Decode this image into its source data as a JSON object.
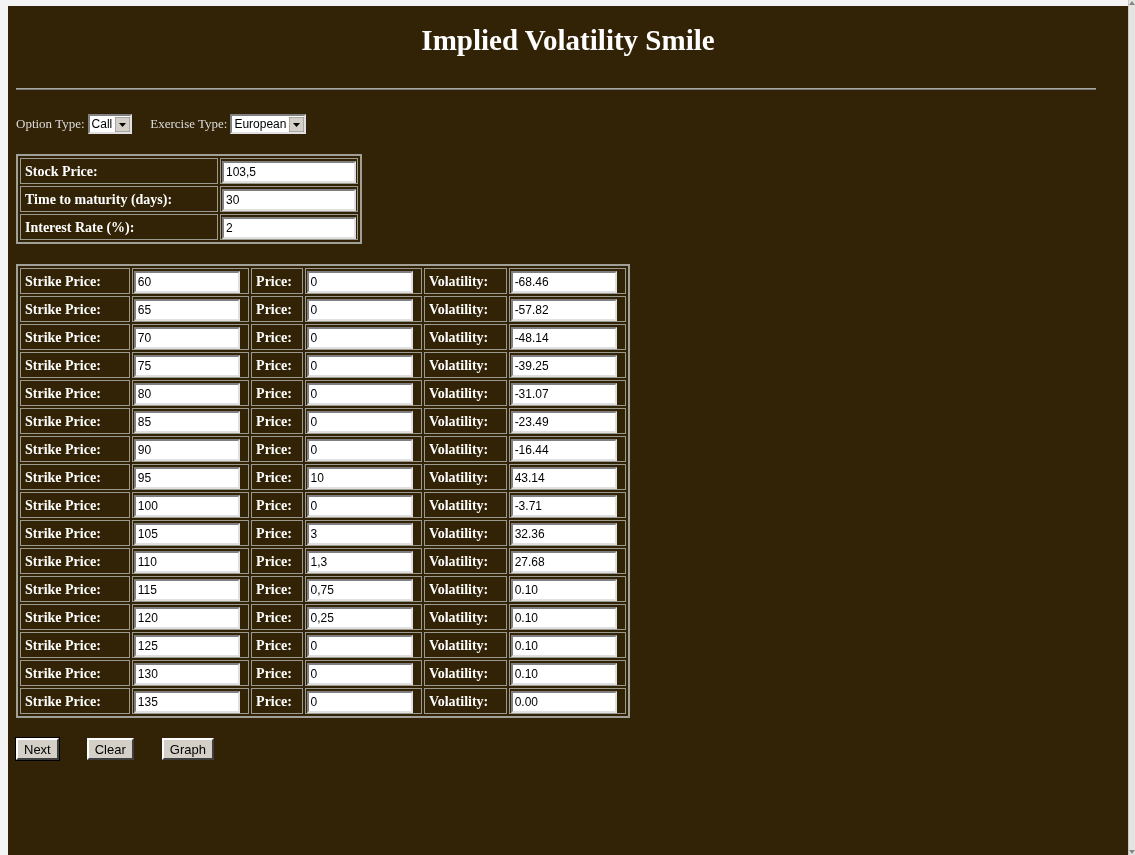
{
  "title": "Implied Volatility Smile",
  "options": [
    {
      "label": "Option Type:",
      "value": "Call"
    },
    {
      "label": "Exercise Type:",
      "value": "European"
    }
  ],
  "inputs": [
    {
      "label": "Stock Price:",
      "value": "103,5"
    },
    {
      "label": "Time to maturity (days):",
      "value": "30"
    },
    {
      "label": "Interest Rate (%):",
      "value": "2"
    }
  ],
  "strikes": [
    {
      "strike_label": "Strike Price:",
      "strike": "60",
      "price_label": "Price:",
      "price": "0",
      "vol_label": "Volatility:",
      "vol": "-68.46"
    },
    {
      "strike_label": "Strike Price:",
      "strike": "65",
      "price_label": "Price:",
      "price": "0",
      "vol_label": "Volatility:",
      "vol": "-57.82"
    },
    {
      "strike_label": "Strike Price:",
      "strike": "70",
      "price_label": "Price:",
      "price": "0",
      "vol_label": "Volatility:",
      "vol": "-48.14"
    },
    {
      "strike_label": "Strike Price:",
      "strike": "75",
      "price_label": "Price:",
      "price": "0",
      "vol_label": "Volatility:",
      "vol": "-39.25"
    },
    {
      "strike_label": "Strike Price:",
      "strike": "80",
      "price_label": "Price:",
      "price": "0",
      "vol_label": "Volatility:",
      "vol": "-31.07"
    },
    {
      "strike_label": "Strike Price:",
      "strike": "85",
      "price_label": "Price:",
      "price": "0",
      "vol_label": "Volatility:",
      "vol": "-23.49"
    },
    {
      "strike_label": "Strike Price:",
      "strike": "90",
      "price_label": "Price:",
      "price": "0",
      "vol_label": "Volatility:",
      "vol": "-16.44"
    },
    {
      "strike_label": "Strike Price:",
      "strike": "95",
      "price_label": "Price:",
      "price": "10",
      "vol_label": "Volatility:",
      "vol": "43.14"
    },
    {
      "strike_label": "Strike Price:",
      "strike": "100",
      "price_label": "Price:",
      "price": "0",
      "vol_label": "Volatility:",
      "vol": "-3.71"
    },
    {
      "strike_label": "Strike Price:",
      "strike": "105",
      "price_label": "Price:",
      "price": "3",
      "vol_label": "Volatility:",
      "vol": "32.36"
    },
    {
      "strike_label": "Strike Price:",
      "strike": "110",
      "price_label": "Price:",
      "price": "1,3",
      "vol_label": "Volatility:",
      "vol": "27.68"
    },
    {
      "strike_label": "Strike Price:",
      "strike": "115",
      "price_label": "Price:",
      "price": "0,75",
      "vol_label": "Volatility:",
      "vol": "0.10"
    },
    {
      "strike_label": "Strike Price:",
      "strike": "120",
      "price_label": "Price:",
      "price": "0,25",
      "vol_label": "Volatility:",
      "vol": "0.10"
    },
    {
      "strike_label": "Strike Price:",
      "strike": "125",
      "price_label": "Price:",
      "price": "0",
      "vol_label": "Volatility:",
      "vol": "0.10"
    },
    {
      "strike_label": "Strike Price:",
      "strike": "130",
      "price_label": "Price:",
      "price": "0",
      "vol_label": "Volatility:",
      "vol": "0.10"
    },
    {
      "strike_label": "Strike Price:",
      "strike": "135",
      "price_label": "Price:",
      "price": "0",
      "vol_label": "Volatility:",
      "vol": "0.00"
    }
  ],
  "buttons": [
    {
      "label": "Next",
      "focused": true
    },
    {
      "label": "Clear",
      "focused": false
    },
    {
      "label": "Graph",
      "focused": false
    }
  ]
}
